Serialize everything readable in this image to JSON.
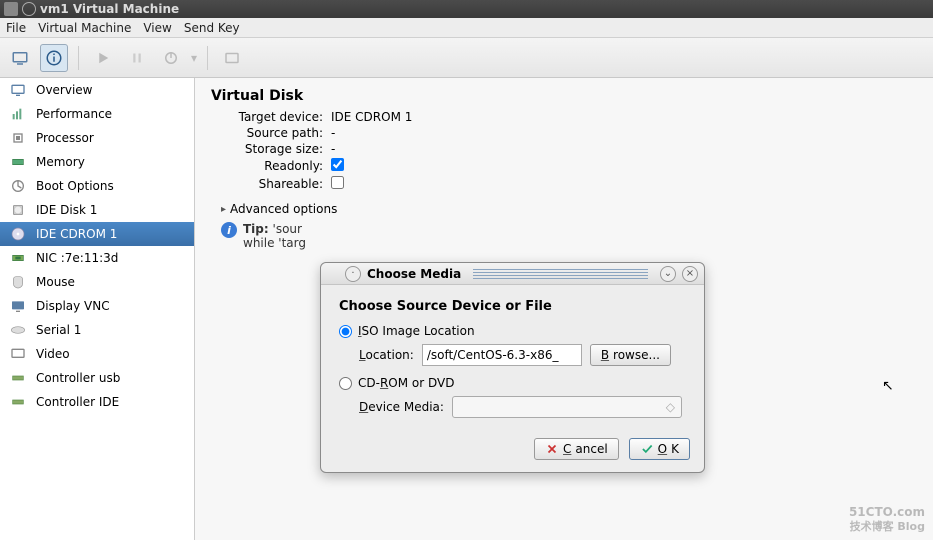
{
  "window": {
    "title": "vm1 Virtual Machine"
  },
  "menubar": [
    "File",
    "Virtual Machine",
    "View",
    "Send Key"
  ],
  "sidebar": {
    "items": [
      {
        "label": "Overview",
        "icon": "monitor"
      },
      {
        "label": "Performance",
        "icon": "perf"
      },
      {
        "label": "Processor",
        "icon": "cpu"
      },
      {
        "label": "Memory",
        "icon": "ram"
      },
      {
        "label": "Boot Options",
        "icon": "boot"
      },
      {
        "label": "IDE Disk 1",
        "icon": "disk"
      },
      {
        "label": "IDE CDROM 1",
        "icon": "cdrom",
        "selected": true
      },
      {
        "label": "NIC :7e:11:3d",
        "icon": "nic"
      },
      {
        "label": "Mouse",
        "icon": "mouse"
      },
      {
        "label": "Display VNC",
        "icon": "display"
      },
      {
        "label": "Serial 1",
        "icon": "serial"
      },
      {
        "label": "Video",
        "icon": "video"
      },
      {
        "label": "Controller usb",
        "icon": "ctrl"
      },
      {
        "label": "Controller IDE",
        "icon": "ctrl"
      }
    ]
  },
  "panel": {
    "title": "Virtual Disk",
    "target_device_label": "Target device:",
    "target_device_value": "IDE CDROM 1",
    "source_path_label": "Source path:",
    "source_path_value": "-",
    "storage_size_label": "Storage size:",
    "storage_size_value": "-",
    "readonly_label": "Readonly:",
    "readonly_checked": true,
    "shareable_label": "Shareable:",
    "shareable_checked": false,
    "advanced_label": "Advanced options",
    "tip_prefix": "Tip:",
    "tip_line1": "'sour",
    "tip_line2": "while 'targ"
  },
  "dialog": {
    "title": "Choose Media",
    "heading": "Choose Source Device or File",
    "radio_iso_label": "ISO Image Location",
    "location_label": "Location:",
    "location_value": "/soft/CentOS-6.3-x86_",
    "browse_label": "Browse...",
    "radio_cd_label": "CD-ROM or DVD",
    "device_media_label": "Device Media:",
    "cancel_label": "Cancel",
    "ok_label": "OK",
    "selected_radio": "iso"
  },
  "watermark": {
    "main": "51CTO.com",
    "sub": "技术博客   Blog"
  }
}
